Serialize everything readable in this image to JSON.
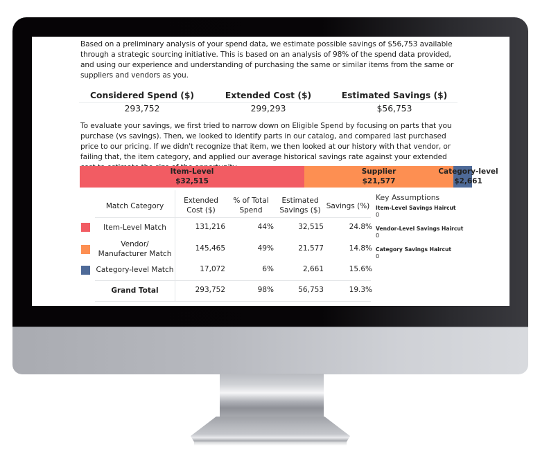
{
  "intro_text": "Based on a preliminary analysis of your spend data, we estimate possible savings of $56,753  available through a strategic sourcing initiative. This is based on an analysis of 98% of the spend data provided, and using our experience and understanding of purchasing the same or similar items from the same or suppliers and vendors as you.",
  "kpis": [
    {
      "label": "Considered Spend ($)",
      "value": "293,752"
    },
    {
      "label": "Extended Cost ($)",
      "value": "299,293"
    },
    {
      "label": "Estimated Savings ($)",
      "value": "$56,753"
    }
  ],
  "method_text": "To evaluate your savings, we first tried to narrow down on Eligible Spend by focusing on parts that you purchase (vs savings). Then, we looked to identify parts in our catalog, and compared last purchased price to our pricing. If we didn't recognize that item, we then looked at our history with that vendor, or failing that, the item category, and applied our average historical savings rate against your extended cost to estimate  the size of the opportunity.",
  "colors": {
    "item_level": "#f25c63",
    "supplier": "#fd8f52",
    "category_level": "#4e6a98"
  },
  "savings_bar": {
    "segments": [
      {
        "label": "Item-Level",
        "value_label": "$32,515",
        "value": 32515,
        "color_key": "item_level"
      },
      {
        "label": "Supplier",
        "value_label": "$21,577",
        "value": 21577,
        "color_key": "supplier"
      },
      {
        "label": "Category-level",
        "value_label": "$2,661",
        "value": 2661,
        "color_key": "category_level"
      }
    ]
  },
  "table": {
    "headers": {
      "category": "Match Category",
      "extended_cost_1": "Extended",
      "extended_cost_2": "Cost ($)",
      "pct_spend_1": "% of Total",
      "pct_spend_2": "Spend",
      "est_savings_1": "Estimated",
      "est_savings_2": "Savings ($)",
      "savings_pct": "Savings (%)"
    },
    "rows": [
      {
        "category": "Item-Level Match",
        "category_line2": "",
        "extended_cost": "131,216",
        "pct_spend": "44%",
        "est_savings": "32,515",
        "savings_pct": "24.8%",
        "color_key": "item_level"
      },
      {
        "category": "Vendor/",
        "category_line2": "Manufacturer Match",
        "extended_cost": "145,465",
        "pct_spend": "49%",
        "est_savings": "21,577",
        "savings_pct": "14.8%",
        "color_key": "supplier"
      },
      {
        "category": "Category-level Match",
        "category_line2": "",
        "extended_cost": "17,072",
        "pct_spend": "6%",
        "est_savings": "2,661",
        "savings_pct": "15.6%",
        "color_key": "category_level"
      }
    ],
    "total": {
      "category": "Grand Total",
      "extended_cost": "293,752",
      "pct_spend": "98%",
      "est_savings": "56,753",
      "savings_pct": "19.3%"
    }
  },
  "assumptions": {
    "title": "Key Assumptions",
    "items": [
      {
        "label": "Item-Level Savings Haircut",
        "value": "0"
      },
      {
        "label": "Vendor-Level Savings Haircut",
        "value": "0"
      },
      {
        "label": "Category Savings Haircut",
        "value": "0"
      }
    ]
  }
}
